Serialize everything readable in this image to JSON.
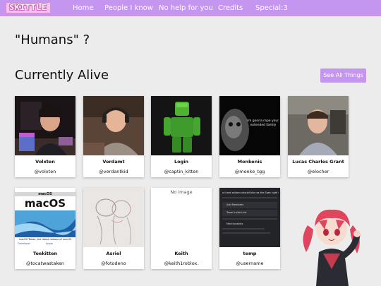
{
  "nav": {
    "logo": "SKITTLE",
    "links": [
      "Home",
      "People I know",
      "No help for you",
      "Credits",
      "Special:3"
    ]
  },
  "humans_heading": "\"Humans\" ?",
  "alive_heading": "Currently Alive",
  "see_all_label": "See All Things",
  "cards": [
    {
      "name": "Volxten",
      "handle": "@volxten"
    },
    {
      "name": "Verdamt",
      "handle": "@verdantkid"
    },
    {
      "name": "Login",
      "handle": "@captin_kitten"
    },
    {
      "name": "Monkenis",
      "handle": "@monke_tgg"
    },
    {
      "name": "Lucas Charles Grant",
      "handle": "@elocher"
    },
    {
      "name": "Toekitten",
      "handle": "@tocatwastaken"
    },
    {
      "name": "Asriel",
      "handle": "@fotodeno"
    },
    {
      "name": "Keith",
      "handle": "@keith1roblox."
    },
    {
      "name": "temp",
      "handle": "@username"
    }
  ],
  "thumb_text": {
    "monkenis_caption": "i'm gonna rape your extended family",
    "macos_header": "macOS",
    "macos_title": "macOS",
    "macos_sub": "macOS Tahoe, the latest release of macOS",
    "macos_links": [
      "Developer",
      "Apple"
    ],
    "keith_alt": "No image",
    "temp_title": "url and actions should blue as the Spec right now",
    "temp_items": [
      "Add Members",
      "Team Invite Link",
      "Mentionables"
    ]
  },
  "colors": {
    "accent": "#c596f0",
    "background": "#ececec"
  }
}
